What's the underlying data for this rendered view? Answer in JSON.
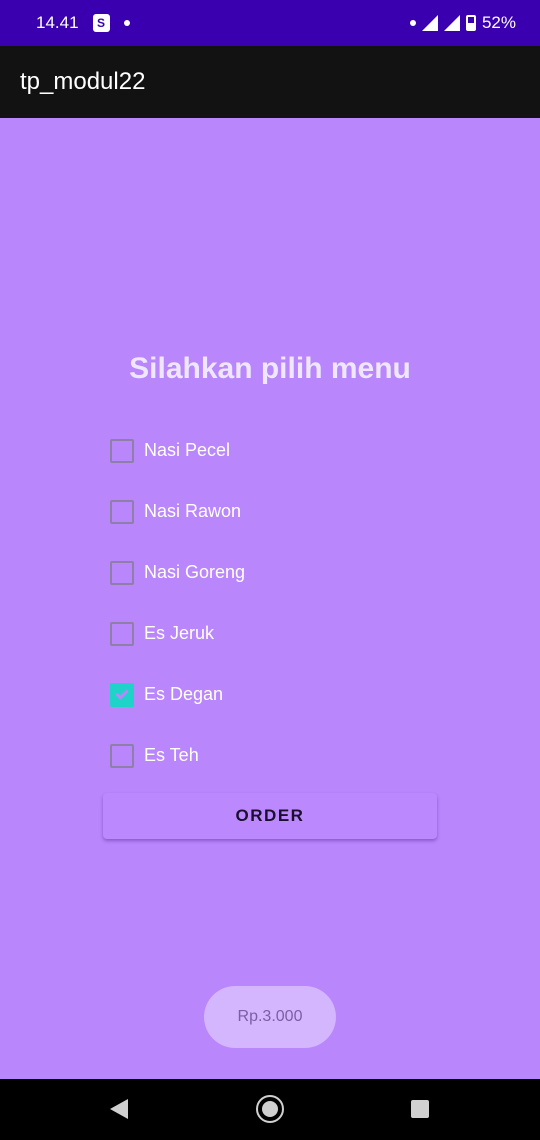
{
  "status_bar": {
    "time": "14.41",
    "shop_icon_letter": "S",
    "battery": "52%"
  },
  "app_bar": {
    "title": "tp_modul22"
  },
  "main": {
    "heading": "Silahkan pilih menu",
    "menu_items": [
      {
        "label": "Nasi Pecel",
        "checked": false
      },
      {
        "label": "Nasi Rawon",
        "checked": false
      },
      {
        "label": "Nasi Goreng",
        "checked": false
      },
      {
        "label": "Es Jeruk",
        "checked": false
      },
      {
        "label": "Es Degan",
        "checked": true
      },
      {
        "label": "Es Teh",
        "checked": false
      }
    ],
    "order_label": "ORDER",
    "price": "Rp.3.000"
  },
  "colors": {
    "background": "#b986fc",
    "status_bar": "#3a00b0",
    "app_bar": "#121212",
    "checkbox_checked": "#1fd3c9"
  }
}
